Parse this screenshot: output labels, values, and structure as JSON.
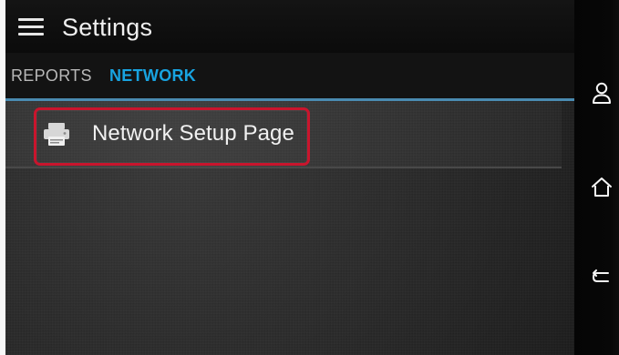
{
  "header": {
    "title": "Settings"
  },
  "tabs": [
    {
      "label": "REPORTS",
      "selected": false
    },
    {
      "label": "NETWORK",
      "selected": true
    }
  ],
  "main": {
    "items": [
      {
        "label": "Network Setup Page",
        "icon": "printer-icon",
        "highlighted": true
      }
    ]
  },
  "navigation": {
    "icons": [
      "user-icon",
      "home-icon",
      "back-icon"
    ]
  },
  "colors": {
    "accent": "#18a3e0",
    "highlight": "#c9152d",
    "app_bg": "#2a2a2a",
    "nav_bg": "#050505"
  }
}
